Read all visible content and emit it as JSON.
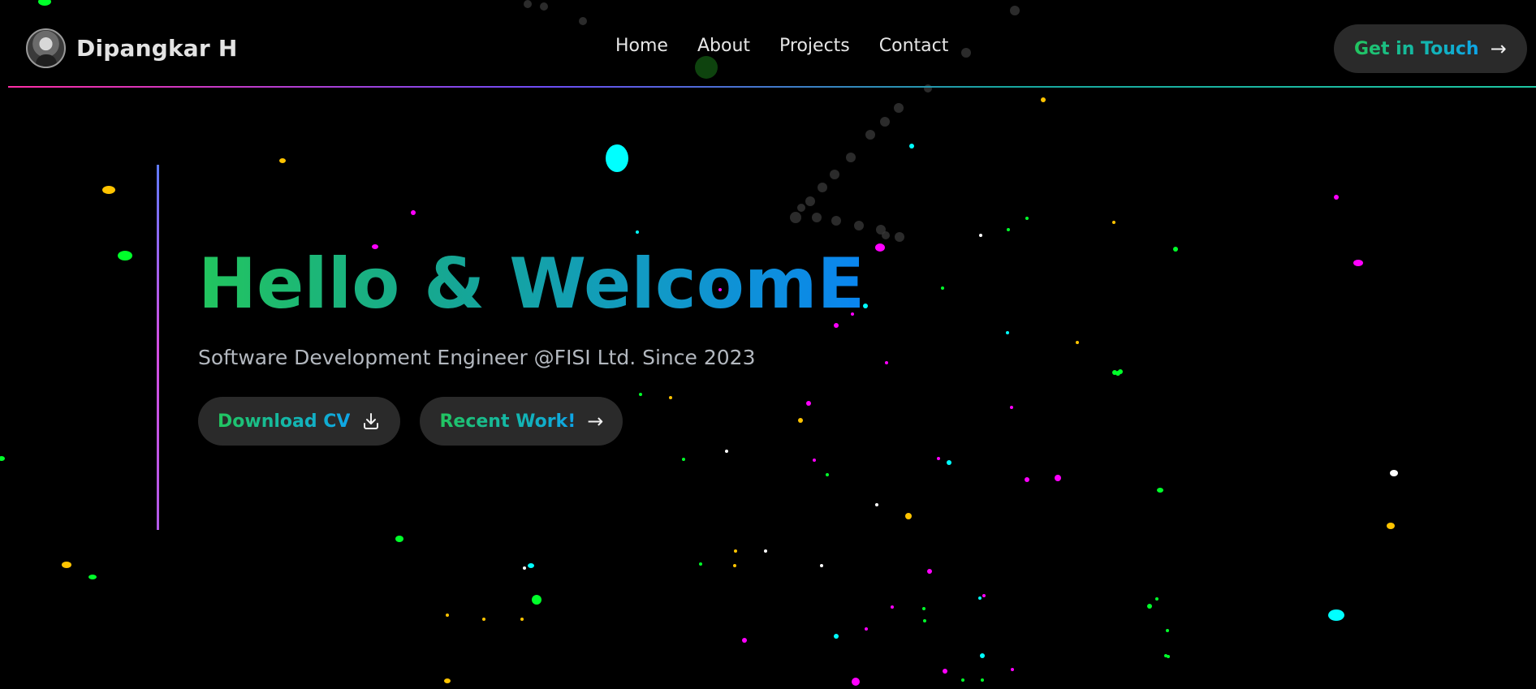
{
  "brand": {
    "name": "Dipangkar H"
  },
  "nav": {
    "items": [
      "Home",
      "About",
      "Projects",
      "Contact"
    ]
  },
  "header": {
    "cta_label": "Get in Touch",
    "cta_icon": "arrow-right-icon"
  },
  "hero": {
    "title": "Hello & WelcomE",
    "subtitle": "Software Development Engineer @FISI Ltd. Since 2023",
    "download_label": "Download CV",
    "download_icon": "download-icon",
    "work_label": "Recent Work!",
    "work_icon": "arrow-right-icon"
  },
  "colors": {
    "background": "#000000",
    "gradient_green": "#22c55e",
    "gradient_blue": "#0a85f0",
    "button_bg": "#2a2a2a",
    "particle_palette": [
      "#ffc400",
      "#00ff2a",
      "#ff00ff",
      "#00ffff",
      "#ffffff"
    ]
  }
}
